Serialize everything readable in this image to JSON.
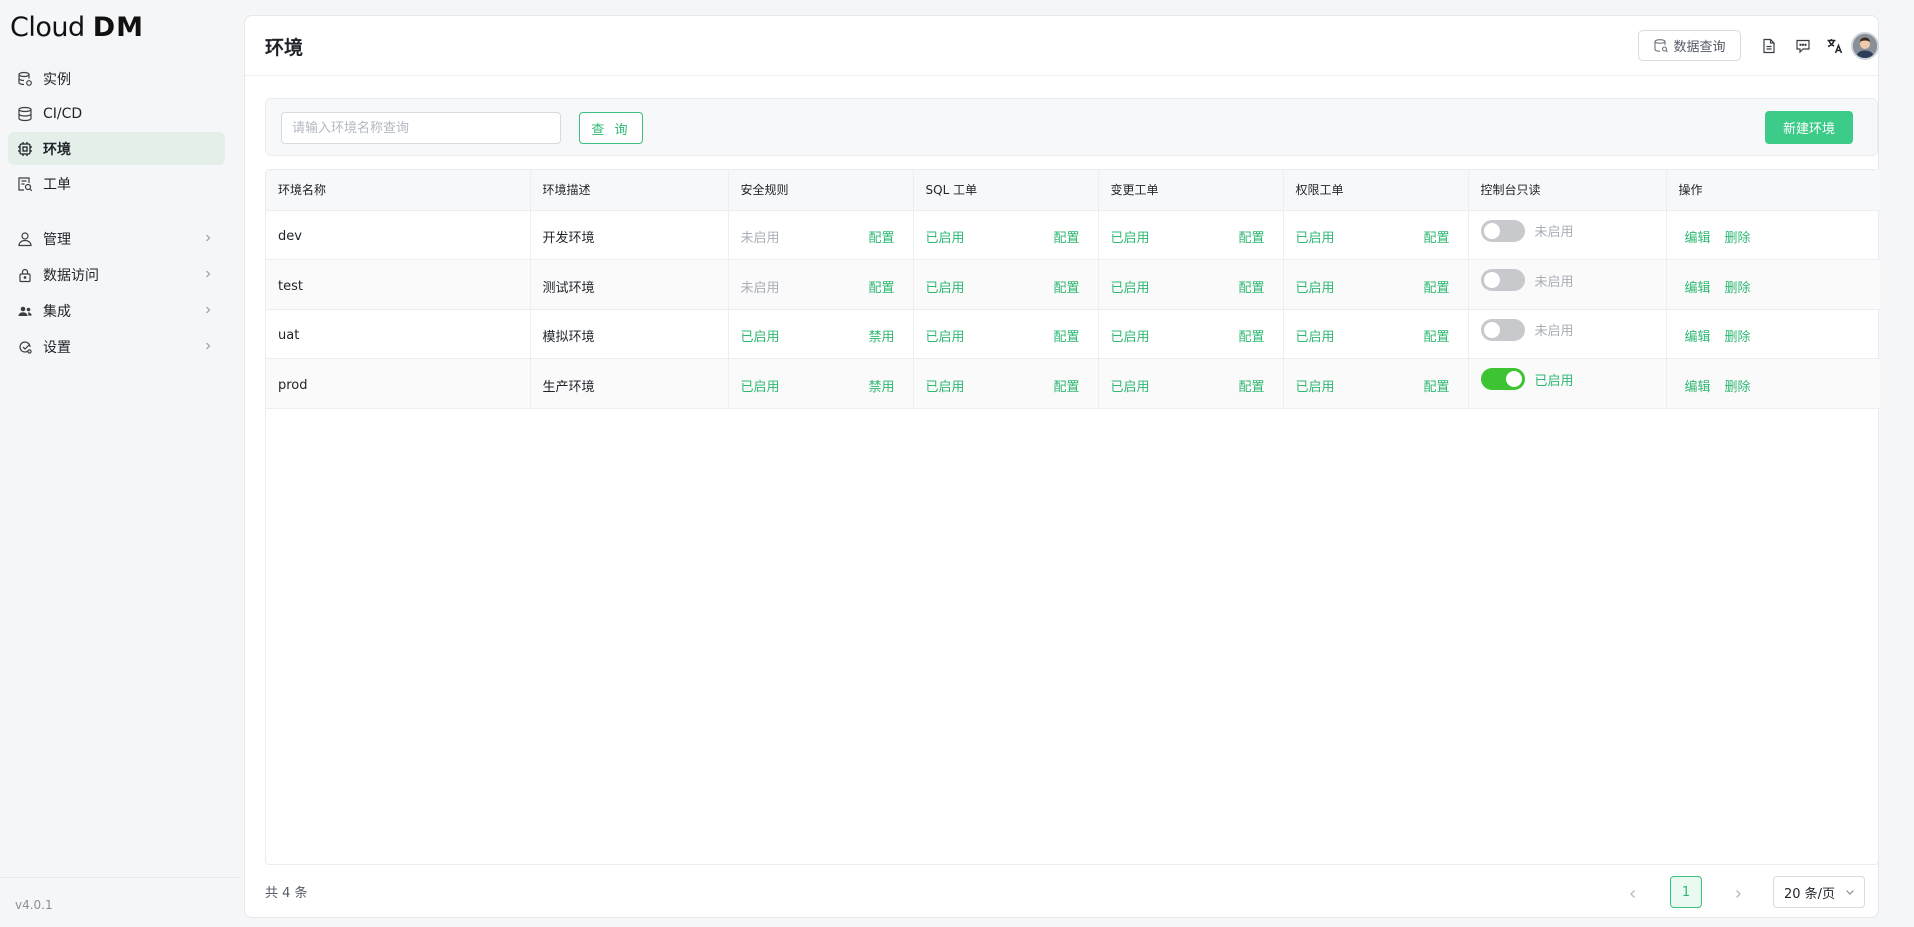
{
  "app": {
    "logo_text_a": "Cloud",
    "logo_text_b": "DM",
    "version": "v4.0.1"
  },
  "sidebar": {
    "items": [
      {
        "label": "实例",
        "icon": "database-icon"
      },
      {
        "label": "CI/CD",
        "icon": "database-stack-icon"
      },
      {
        "label": "环境",
        "icon": "chip-icon",
        "active": true
      },
      {
        "label": "工单",
        "icon": "ticket-icon"
      },
      {
        "label": "管理",
        "icon": "user-icon"
      },
      {
        "label": "数据访问",
        "icon": "lock-icon"
      },
      {
        "label": "集成",
        "icon": "users-icon"
      },
      {
        "label": "设置",
        "icon": "settings-icon"
      }
    ]
  },
  "header": {
    "title": "环境",
    "data_query_label": "数据查询"
  },
  "filter": {
    "search_placeholder": "请输入环境名称查询",
    "query_label": "查 询",
    "new_label": "新建环境"
  },
  "table": {
    "columns": [
      "环境名称",
      "环境描述",
      "安全规则",
      "SQL 工单",
      "变更工单",
      "权限工单",
      "控制台只读",
      "操作"
    ],
    "rows": [
      {
        "name": "dev",
        "desc": "开发环境",
        "security": {
          "status": "未启用",
          "action": "配置"
        },
        "sql": {
          "status": "已启用",
          "action": "配置"
        },
        "change": {
          "status": "已启用",
          "action": "配置"
        },
        "perm": {
          "status": "已启用",
          "action": "配置"
        },
        "readonly": {
          "on": false,
          "label": "未启用"
        },
        "ops": {
          "edit": "编辑",
          "delete": "删除"
        }
      },
      {
        "name": "test",
        "desc": "测试环境",
        "security": {
          "status": "未启用",
          "action": "配置"
        },
        "sql": {
          "status": "已启用",
          "action": "配置"
        },
        "change": {
          "status": "已启用",
          "action": "配置"
        },
        "perm": {
          "status": "已启用",
          "action": "配置"
        },
        "readonly": {
          "on": false,
          "label": "未启用"
        },
        "ops": {
          "edit": "编辑",
          "delete": "删除"
        }
      },
      {
        "name": "uat",
        "desc": "模拟环境",
        "security": {
          "status": "已启用",
          "action": "禁用"
        },
        "sql": {
          "status": "已启用",
          "action": "配置"
        },
        "change": {
          "status": "已启用",
          "action": "配置"
        },
        "perm": {
          "status": "已启用",
          "action": "配置"
        },
        "readonly": {
          "on": false,
          "label": "未启用"
        },
        "ops": {
          "edit": "编辑",
          "delete": "删除"
        }
      },
      {
        "name": "prod",
        "desc": "生产环境",
        "security": {
          "status": "已启用",
          "action": "禁用"
        },
        "sql": {
          "status": "已启用",
          "action": "配置"
        },
        "change": {
          "status": "已启用",
          "action": "配置"
        },
        "perm": {
          "status": "已启用",
          "action": "配置"
        },
        "readonly": {
          "on": true,
          "label": "已启用"
        },
        "ops": {
          "edit": "编辑",
          "delete": "删除"
        }
      }
    ]
  },
  "footer": {
    "total": "共 4 条",
    "current_page": "1",
    "page_size": "20 条/页"
  },
  "colors": {
    "accent": "#2fb872",
    "toggle_on": "#3ec332",
    "active_nav_bg": "#e4efea"
  }
}
